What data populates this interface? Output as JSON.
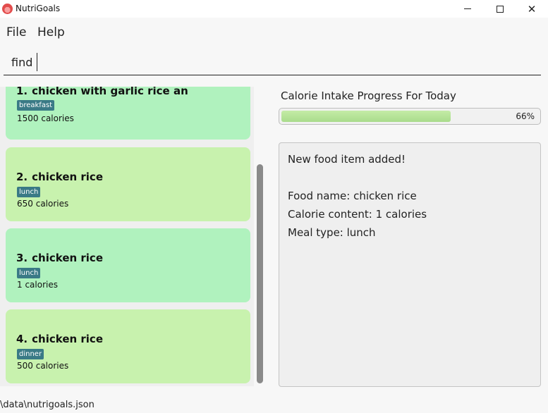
{
  "window": {
    "title": "NutriGoals",
    "minimize_symbol": "",
    "maximize_symbol": "",
    "close_symbol": "✕"
  },
  "menu": {
    "file_label": "File",
    "help_label": "Help"
  },
  "command": {
    "value": "find"
  },
  "food_list": [
    {
      "index": "1.",
      "name": "chicken with garlic rice an",
      "tag": "breakfast",
      "calories": "1500 calories"
    },
    {
      "index": "2.",
      "name": "chicken rice",
      "tag": "lunch",
      "calories": "650 calories"
    },
    {
      "index": "3.",
      "name": "chicken rice",
      "tag": "lunch",
      "calories": "1 calories"
    },
    {
      "index": "4.",
      "name": "chicken rice",
      "tag": "dinner",
      "calories": "500 calories"
    }
  ],
  "progress": {
    "label": "Calorie Intake Progress For Today",
    "percent_text": "66%",
    "fraction": 0.66
  },
  "result": {
    "lines": [
      "New food item added!",
      "",
      "Food name: chicken rice",
      "Calorie content: 1 calories",
      "Meal type: lunch"
    ]
  },
  "status": {
    "file_path": "\\data\\nutrigoals.json"
  },
  "colors": {
    "card_green_a": "#b0f2be",
    "card_green_b": "#c8f2ae",
    "tag_bg": "#3a7a86",
    "progress_fill": "#a9dc8c"
  }
}
